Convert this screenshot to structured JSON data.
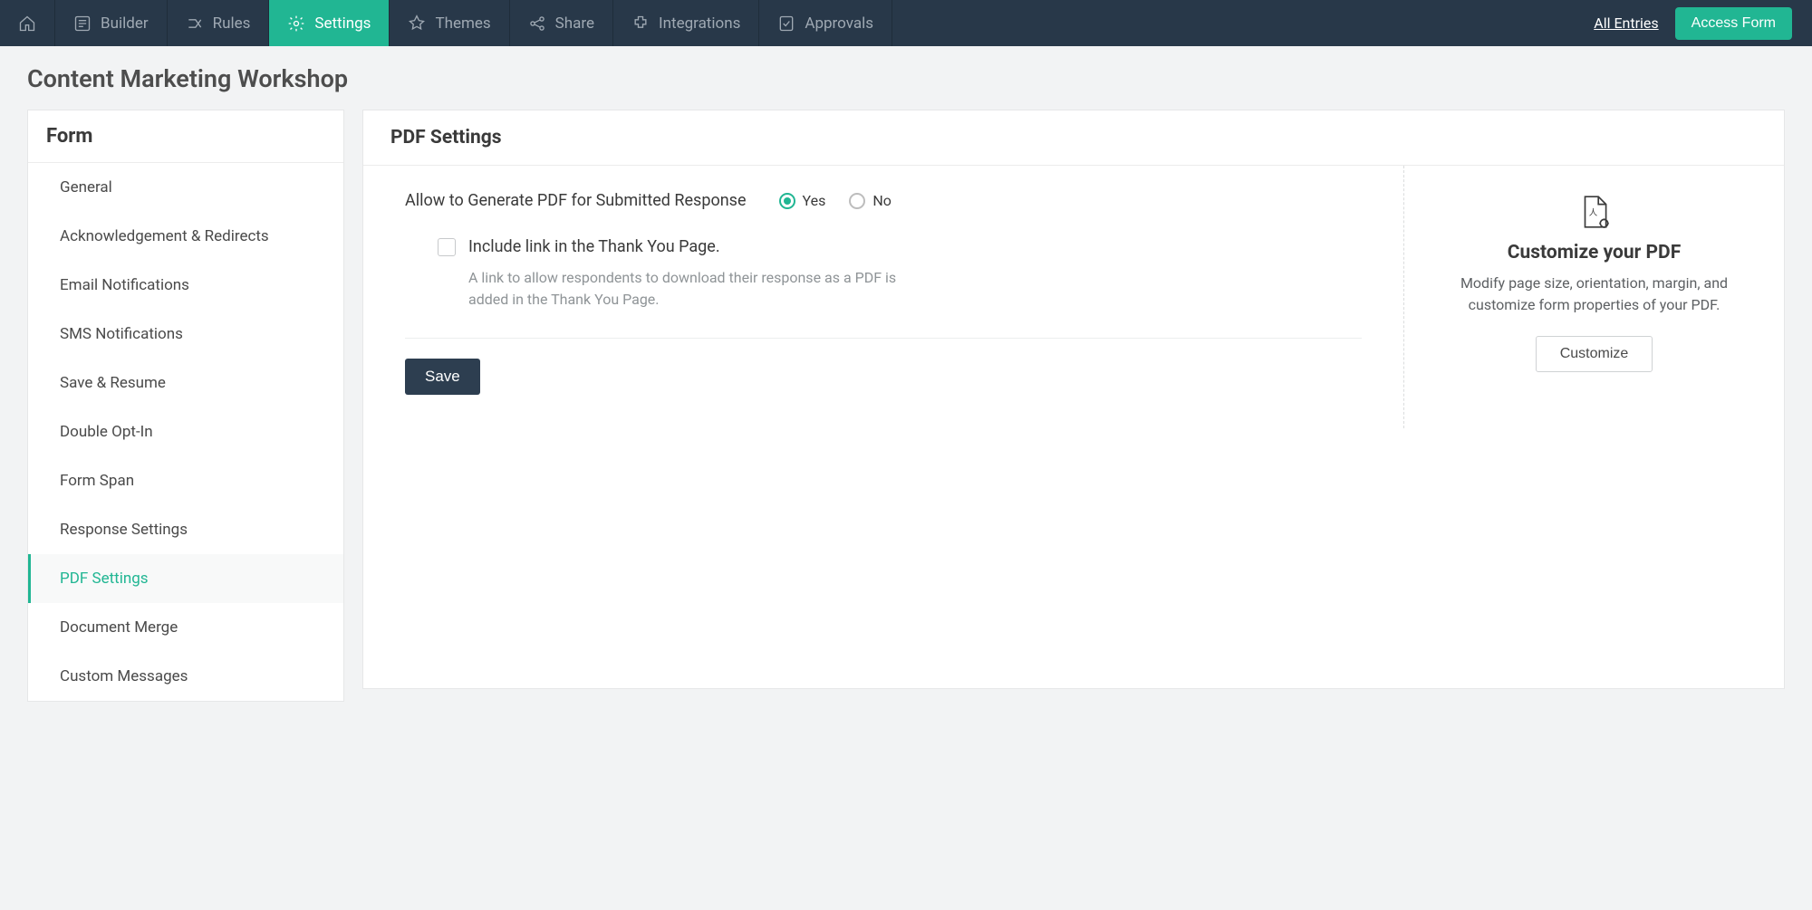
{
  "topnav": {
    "items": [
      {
        "label": "Builder"
      },
      {
        "label": "Rules"
      },
      {
        "label": "Settings"
      },
      {
        "label": "Themes"
      },
      {
        "label": "Share"
      },
      {
        "label": "Integrations"
      },
      {
        "label": "Approvals"
      }
    ],
    "all_entries": "All Entries",
    "access_form": "Access Form"
  },
  "page_title": "Content Marketing Workshop",
  "sidebar": {
    "header": "Form",
    "items": [
      {
        "label": "General"
      },
      {
        "label": "Acknowledgement & Redirects"
      },
      {
        "label": "Email Notifications"
      },
      {
        "label": "SMS Notifications"
      },
      {
        "label": "Save & Resume"
      },
      {
        "label": "Double Opt-In"
      },
      {
        "label": "Form Span"
      },
      {
        "label": "Response Settings"
      },
      {
        "label": "PDF Settings"
      },
      {
        "label": "Document Merge"
      },
      {
        "label": "Custom Messages"
      }
    ]
  },
  "main": {
    "header": "PDF Settings",
    "allow_label": "Allow to Generate PDF for Submitted Response",
    "yes": "Yes",
    "no": "No",
    "include_label": "Include link in the Thank You Page.",
    "include_desc": "A link to allow respondents to download their response as a PDF is added in the Thank You Page.",
    "save": "Save",
    "right_title": "Customize your PDF",
    "right_desc": "Modify page size, orientation, margin, and customize form properties of your PDF.",
    "customize": "Customize"
  }
}
